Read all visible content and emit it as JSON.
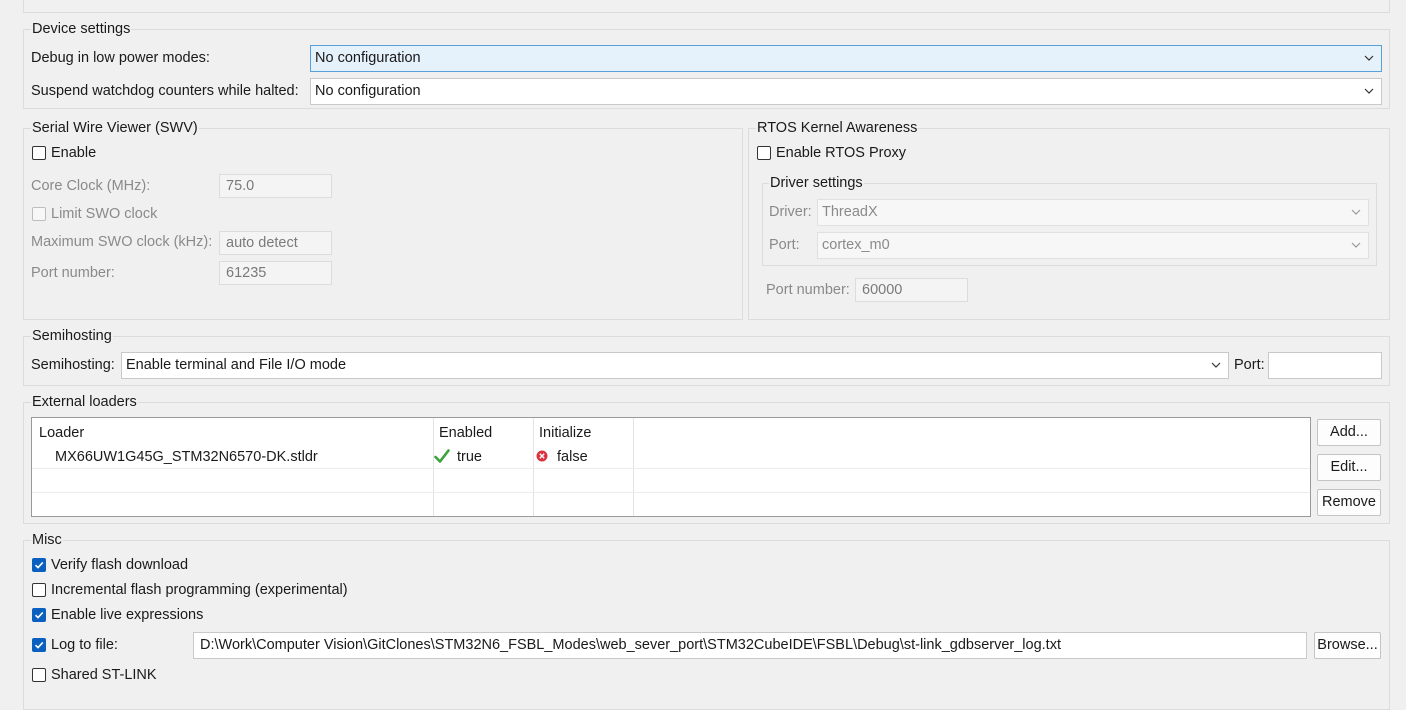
{
  "device_settings": {
    "title": "Device settings",
    "debug_low_power_label": "Debug in low power modes:",
    "debug_low_power_value": "No configuration",
    "suspend_watchdog_label": "Suspend watchdog counters while halted:",
    "suspend_watchdog_value": "No configuration"
  },
  "swv": {
    "title": "Serial Wire Viewer (SWV)",
    "enable_label": "Enable",
    "enable_checked": false,
    "core_clock_label": "Core Clock (MHz):",
    "core_clock_value": "75.0",
    "limit_swo_label": "Limit SWO clock",
    "max_swo_label": "Maximum SWO clock (kHz):",
    "max_swo_value": "auto detect",
    "port_label": "Port number:",
    "port_value": "61235"
  },
  "rtos": {
    "title": "RTOS Kernel Awareness",
    "enable_label": "Enable RTOS Proxy",
    "enable_checked": false,
    "driver_settings_title": "Driver settings",
    "driver_label": "Driver:",
    "driver_value": "ThreadX",
    "port_label": "Port:",
    "port_value": "cortex_m0",
    "port_number_label": "Port number:",
    "port_number_value": "60000"
  },
  "semihosting": {
    "title": "Semihosting",
    "mode_label": "Semihosting:",
    "mode_value": "Enable terminal and File I/O mode",
    "port_label": "Port:",
    "port_value": ""
  },
  "external_loaders": {
    "title": "External loaders",
    "columns": [
      "Loader",
      "Enabled",
      "Initialize"
    ],
    "rows": [
      {
        "loader": "MX66UW1G45G_STM32N6570-DK.stldr",
        "enabled": "true",
        "initialize": "false"
      }
    ],
    "add_label": "Add...",
    "edit_label": "Edit...",
    "remove_label": "Remove"
  },
  "misc": {
    "title": "Misc",
    "verify_flash_label": "Verify flash download",
    "incremental_label": "Incremental flash programming (experimental)",
    "live_expr_label": "Enable live expressions",
    "log_label": "Log to file:",
    "log_path": "D:\\Work\\Computer Vision\\GitClones\\STM32N6_FSBL_Modes\\web_sever_port\\STM32CubeIDE\\FSBL\\Debug\\st-link_gdbserver_log.txt",
    "browse_label": "Browse...",
    "shared_stlink_label": "Shared ST-LINK"
  },
  "colors": {
    "accent": "#0a5fbf",
    "focus_fill": "#e5f1fb",
    "check_green": "#3aa33a",
    "error_red": "#d9333f"
  },
  "icons": {
    "enabled_icon": "checkmark-icon",
    "initialize_icon": "error-icon"
  }
}
